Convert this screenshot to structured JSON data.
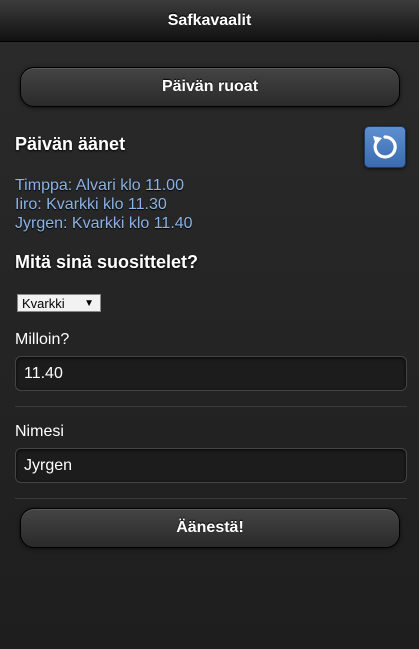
{
  "header": {
    "title": "Safkavaalit"
  },
  "main": {
    "today_meals_button": "Päivän ruoat",
    "votes_title": "Päivän äänet",
    "votes": [
      "Timppa: Alvari klo 11.00",
      "Iiro: Kvarkki klo 11.30",
      "Jyrgen: Kvarkki klo 11.40"
    ],
    "recommend_title": "Mitä sinä suosittelet?",
    "restaurant_select": {
      "selected": "Kvarkki"
    },
    "time_label": "Milloin?",
    "time_value": "11.40",
    "name_label": "Nimesi",
    "name_value": "Jyrgen",
    "vote_button": "Äänestä!"
  },
  "icons": {
    "refresh": "refresh-icon",
    "dropdown": "dropdown-arrow-icon"
  },
  "colors": {
    "accent": "#4a7cc0",
    "vote_text": "#8bb3e5"
  }
}
